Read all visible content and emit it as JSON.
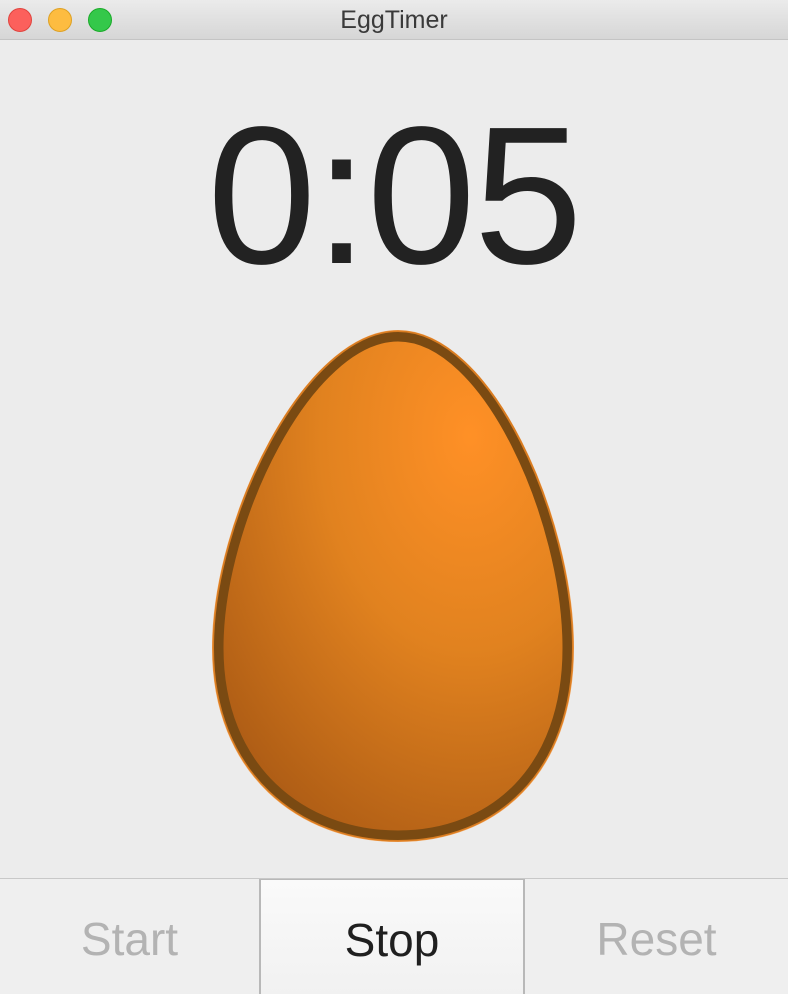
{
  "window": {
    "title": "EggTimer"
  },
  "timer": {
    "display": "0:05"
  },
  "egg": {
    "icon": "egg-icon",
    "fill_color": "#e0801c",
    "outline_color": "#7a4a12"
  },
  "controls": {
    "start_label": "Start",
    "stop_label": "Stop",
    "reset_label": "Reset"
  }
}
